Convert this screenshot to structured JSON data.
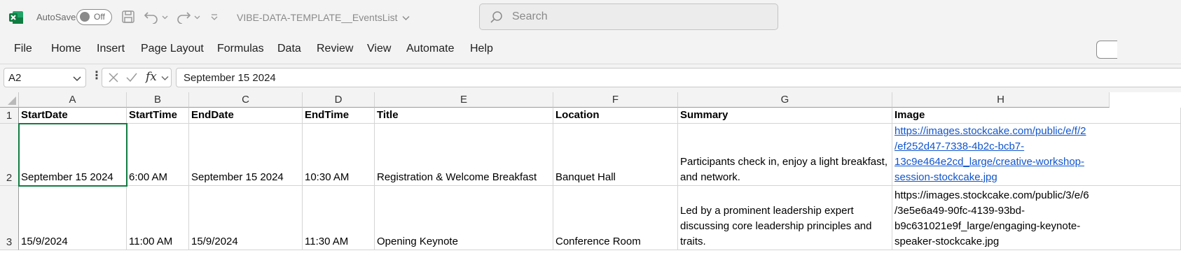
{
  "titlebar": {
    "app_icon": "excel-logo-icon",
    "autosave_label": "AutoSave",
    "autosave_state": "Off",
    "document_title": "VIBE-DATA-TEMPLATE__EventsList",
    "search_placeholder": "Search"
  },
  "menu": {
    "items": [
      "File",
      "Home",
      "Insert",
      "Page Layout",
      "Formulas",
      "Data",
      "Review",
      "View",
      "Automate",
      "Help"
    ]
  },
  "formula_bar": {
    "name_box": "A2",
    "formula_value": "September 15 2024",
    "fx_label": "fx"
  },
  "sheet": {
    "columns": [
      "A",
      "B",
      "C",
      "D",
      "E",
      "F",
      "G",
      "H"
    ],
    "row_numbers": [
      "1",
      "2",
      "3"
    ],
    "headers": [
      "StartDate",
      "StartTime",
      "EndDate",
      "EndTime",
      "Title",
      "Location",
      "Summary",
      "Image"
    ],
    "rows": [
      [
        "September 15 2024",
        "6:00 AM",
        "September 15 2024",
        "10:30 AM",
        "Registration & Welcome Breakfast",
        "Banquet Hall",
        "Participants check in, enjoy a light breakfast, and network.",
        "https://images.stockcake.com/public/e/f/2/ef252d47-7338-4b2c-bcb7-13c9e464e2cd_large/creative-workshop-session-stockcake.jpg"
      ],
      [
        "15/9/2024",
        "11:00 AM",
        "15/9/2024",
        "11:30 AM",
        "Opening Keynote",
        "Conference Room",
        "Led by a prominent leadership expert discussing core leadership principles and traits.",
        "https://images.stockcake.com/public/3/e/6/3e5e6a49-90fc-4139-93bd-b9c631021e9f_large/engaging-keynote-speaker-stockcake.jpg"
      ]
    ],
    "image_lines": [
      [
        "https://images.stockcake.com/public/e/f/2",
        "/ef252d47-7338-4b2c-bcb7-",
        "13c9e464e2cd_large/creative-workshop-",
        "session-stockcake.jpg"
      ],
      [
        "https://images.stockcake.com/public/3/e/6",
        "/3e5e6a49-90fc-4139-93bd-",
        "b9c631021e9f_large/engaging-keynote-",
        "speaker-stockcake.jpg"
      ]
    ]
  },
  "colors": {
    "accent": "#107c41",
    "hyperlink": "#1155cc",
    "chrome_bg": "#f3f3f3"
  }
}
